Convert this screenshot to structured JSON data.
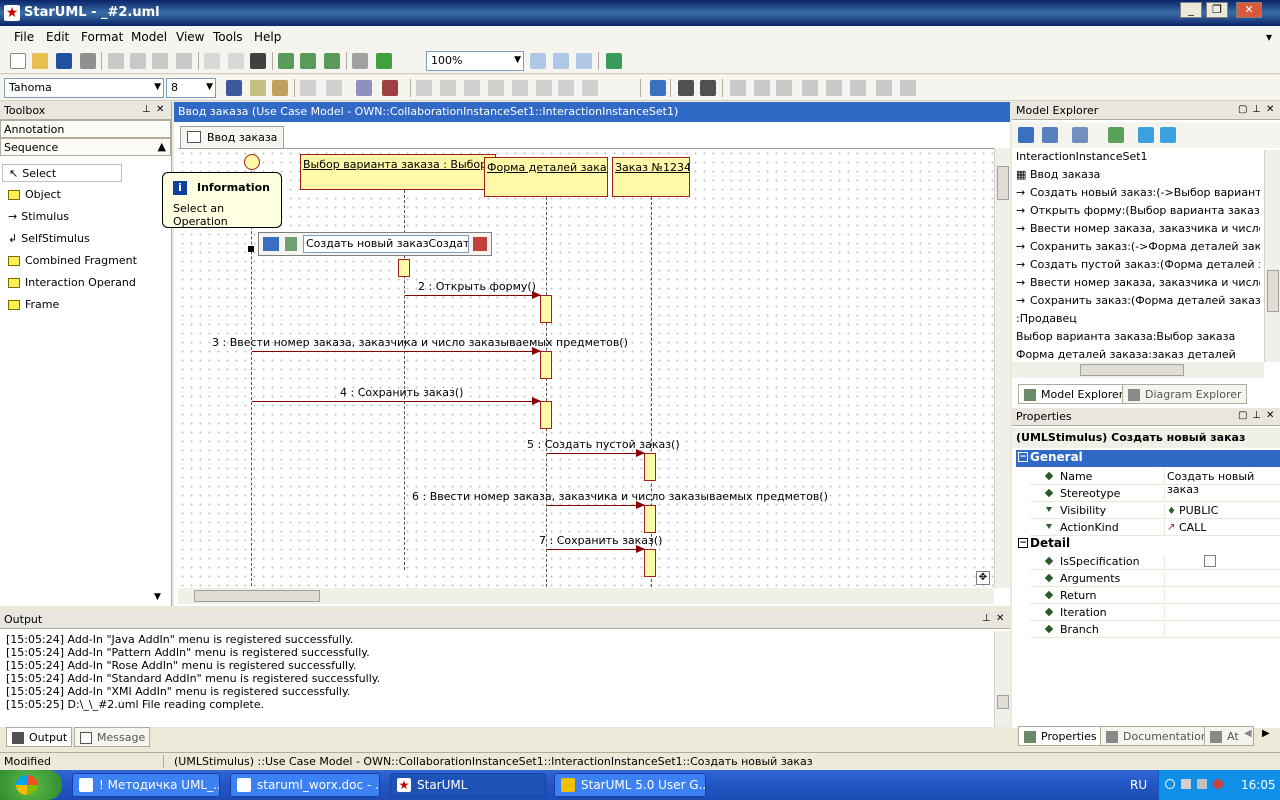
{
  "window": {
    "title": "StarUML - _#2.uml"
  },
  "menu": [
    "File",
    "Edit",
    "Format",
    "Model",
    "View",
    "Tools",
    "Help"
  ],
  "toolbar": {
    "zoom": "100%",
    "font": "Tahoma",
    "font_size": "8"
  },
  "toolbox": {
    "title": "Toolbox",
    "sections": [
      "Annotation",
      "Sequence"
    ],
    "items": [
      "Select",
      "Object",
      "Stimulus",
      "SelfStimulus",
      "Combined Fragment",
      "Interaction Operand",
      "Frame"
    ]
  },
  "popup": {
    "title": "Information",
    "text": "Select an Operation"
  },
  "inline_edit": {
    "value": "Создать новый заказСоздать"
  },
  "document": {
    "header": "Ввод заказа (Use Case Model - OWN::CollaborationInstanceSet1::InteractionInstanceSet1)",
    "tab": "Ввод заказа",
    "objects": [
      "Выбор варианта заказа : Выбор заказа",
      "Форма деталей заказа",
      "Заказ №1234"
    ],
    "messages": [
      "2 : Открыть форму()",
      "3 : Ввести номер заказа, заказчика и число заказываемых предметов()",
      "4 : Сохранить заказ()",
      "5 : Создать пустой заказ()",
      "6 : Ввести номер заказа, заказчика и число заказываемых предметов()",
      "7 : Сохранить заказ()"
    ]
  },
  "model_explorer": {
    "title": "Model Explorer",
    "items": [
      "InteractionInstanceSet1",
      "Ввод заказа",
      "Создать новый заказ:(->Выбор варианта за",
      "Открыть форму:(Выбор варианта заказа->Ф",
      "Ввести номер заказа, заказчика и число зак",
      "Сохранить заказ:(->Форма деталей заказа)",
      "Создать пустой заказ:(Форма деталей заказ",
      "Ввести номер заказа, заказчика и число зак",
      "Сохранить заказ:(Форма деталей заказа->З",
      ":Продавец",
      "Выбор варианта заказа:Выбор заказа",
      "Форма деталей заказа:заказ деталей"
    ],
    "tabs": [
      "Model Explorer",
      "Diagram Explorer"
    ]
  },
  "properties": {
    "title": "Properties",
    "subject": "(UMLStimulus) Создать новый заказ",
    "general_label": "General",
    "detail_label": "Detail",
    "general": [
      {
        "name": "Name",
        "value": "Создать новый заказ"
      },
      {
        "name": "Stereotype",
        "value": ""
      },
      {
        "name": "Visibility",
        "value": "PUBLIC"
      },
      {
        "name": "ActionKind",
        "value": "CALL"
      }
    ],
    "detail": [
      {
        "name": "IsSpecification",
        "value": ""
      },
      {
        "name": "Arguments",
        "value": ""
      },
      {
        "name": "Return",
        "value": ""
      },
      {
        "name": "Iteration",
        "value": ""
      },
      {
        "name": "Branch",
        "value": ""
      }
    ],
    "tabs": [
      "Properties",
      "Documentation",
      "At"
    ]
  },
  "output": {
    "title": "Output",
    "lines": [
      "[15:05:24]  Add-In \"Java AddIn\" menu is registered successfully.",
      "[15:05:24]  Add-In \"Pattern AddIn\" menu is registered successfully.",
      "[15:05:24]  Add-In \"Rose AddIn\" menu is registered successfully.",
      "[15:05:24]  Add-In \"Standard AddIn\" menu is registered successfully.",
      "[15:05:24]  Add-In \"XMI AddIn\" menu is registered successfully.",
      "[15:05:25]  D:\\_\\_#2.uml File reading complete."
    ],
    "tabs": [
      "Output",
      "Message"
    ]
  },
  "status": {
    "left": "Modified",
    "path": "(UMLStimulus) ::Use Case Model - OWN::CollaborationInstanceSet1::InteractionInstanceSet1::Создать новый заказ"
  },
  "taskbar": {
    "tasks": [
      "! Методичка UML_...",
      "staruml_worx.doc - ...",
      "StarUML",
      "StarUML 5.0 User G..."
    ],
    "lang": "RU",
    "clock": "16:05"
  }
}
